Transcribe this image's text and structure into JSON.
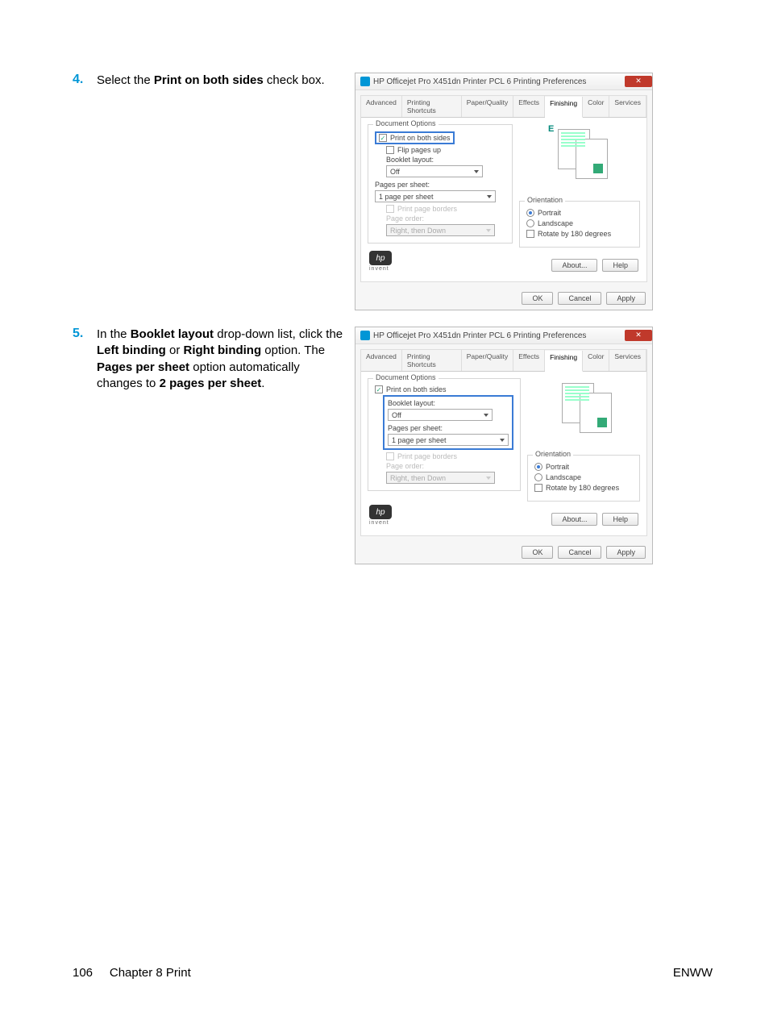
{
  "steps": {
    "s4": {
      "num": "4.",
      "text_before": "Select the ",
      "bold1": "Print on both sides",
      "text_after": " check box."
    },
    "s5": {
      "num": "5.",
      "t1": "In the ",
      "b1": "Booklet layout",
      "t2": " drop-down list, click the ",
      "b2": "Left binding",
      "t3": " or ",
      "b3": "Right binding",
      "t4": " option. The ",
      "b4": "Pages per sheet",
      "t5": " option automatically changes to ",
      "b5": "2 pages per sheet",
      "t6": "."
    }
  },
  "dialog": {
    "title": "HP Officejet Pro X451dn Printer PCL 6 Printing Preferences",
    "close": "✕",
    "tabs": {
      "advanced": "Advanced",
      "shortcuts": "Printing Shortcuts",
      "paper": "Paper/Quality",
      "effects": "Effects",
      "finishing": "Finishing",
      "color": "Color",
      "services": "Services"
    },
    "doc_options": "Document Options",
    "print_both": "Print on both sides",
    "flip_up": "Flip pages up",
    "booklet_layout": "Booklet layout:",
    "off": "Off",
    "pages_per_sheet": "Pages per sheet:",
    "one_pps": "1 page per sheet",
    "print_borders": "Print page borders",
    "page_order": "Page order:",
    "right_down": "Right, then Down",
    "orientation": "Orientation",
    "portrait": "Portrait",
    "landscape": "Landscape",
    "rotate": "Rotate by 180 degrees",
    "about": "About...",
    "help": "Help",
    "ok": "OK",
    "cancel": "Cancel",
    "apply": "Apply",
    "invent": "invent",
    "preview_e": "E"
  },
  "footer": {
    "page": "106",
    "chapter": "Chapter 8   Print",
    "right": "ENWW"
  }
}
